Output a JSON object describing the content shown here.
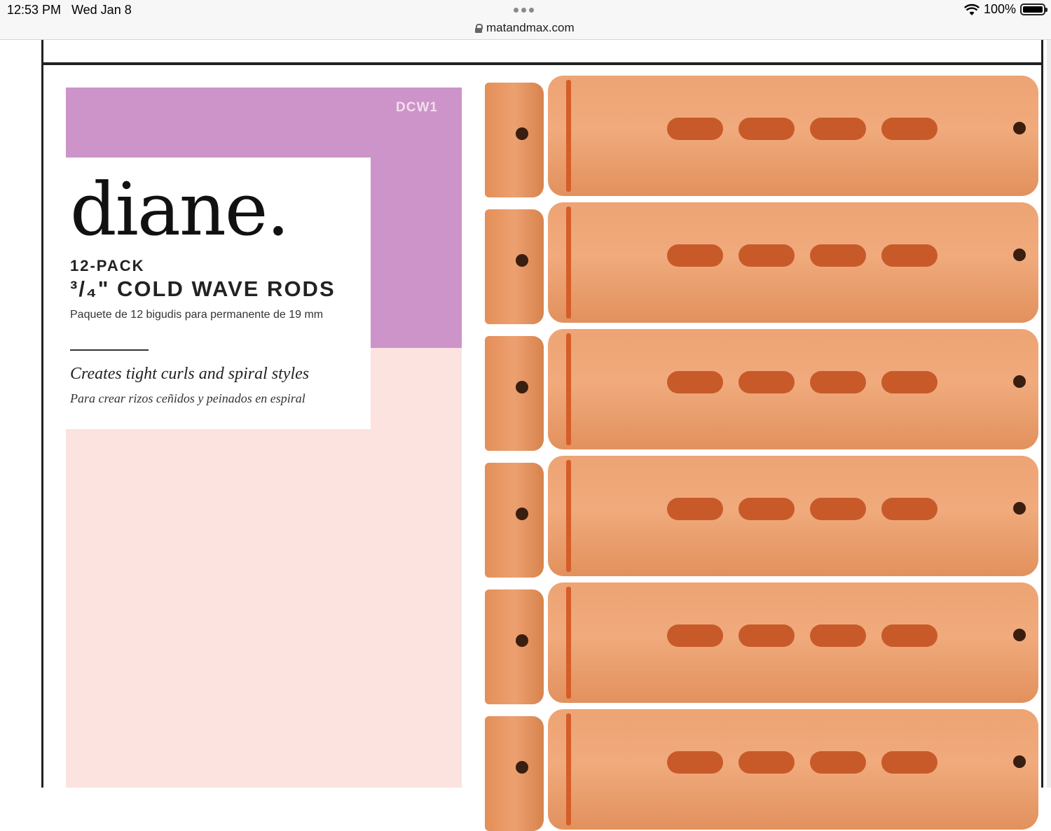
{
  "status_bar": {
    "time": "12:53 PM",
    "date": "Wed Jan 8",
    "url": "matandmax.com",
    "battery": "100%",
    "icons": [
      "more-dots-icon",
      "lock-icon",
      "wifi-icon",
      "battery-icon"
    ]
  },
  "package": {
    "code": "DCW1",
    "brand": "diane.",
    "pack": "12-PACK",
    "product": "³/₄\" COLD WAVE RODS",
    "product_es": "Paquete de 12 bigudis para permanente de 19 mm",
    "tagline": "Creates tight curls and spiral styles",
    "tagline_es": "Para crear rizos ceñidos y peinados en espiral",
    "colors": {
      "purple_panel": "#cd94c9",
      "pink_panel": "#fce3df",
      "rod_orange": "#eea474",
      "rod_band": "#d55d2a"
    }
  }
}
